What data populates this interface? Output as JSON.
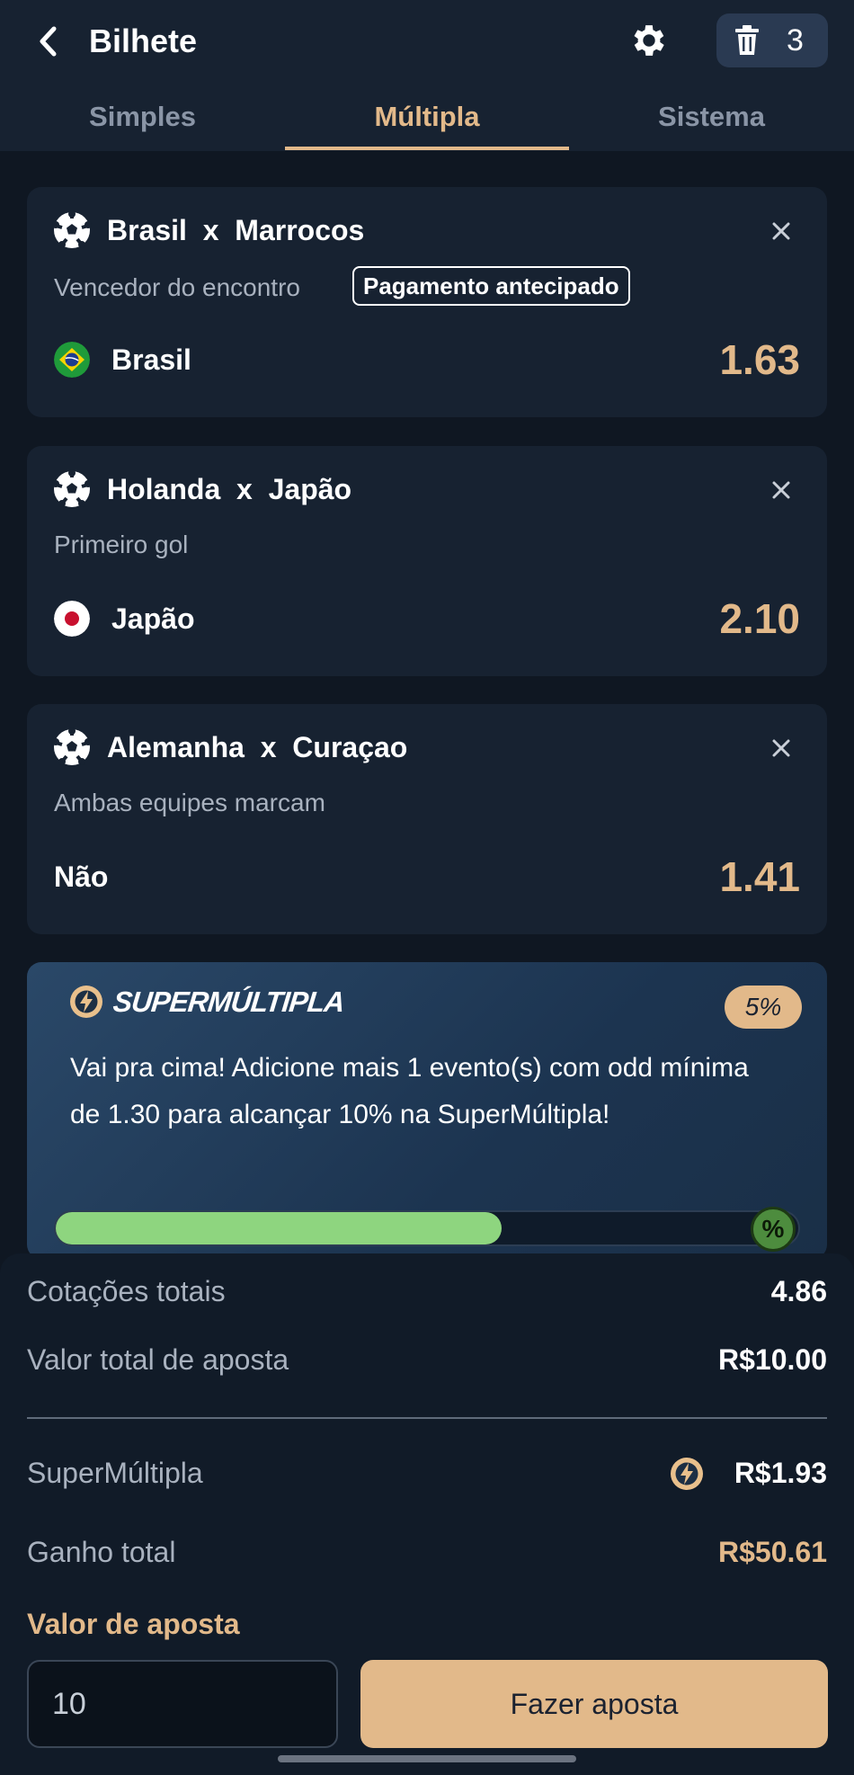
{
  "header": {
    "title": "Bilhete",
    "trash_count": "3"
  },
  "tabs": [
    {
      "label": "Simples",
      "active": false
    },
    {
      "label": "Múltipla",
      "active": true
    },
    {
      "label": "Sistema",
      "active": false
    }
  ],
  "bets": [
    {
      "home": "Brasil",
      "sep": "x",
      "away": "Marrocos",
      "market": "Vencedor do encontro",
      "badge": "Pagamento antecipado",
      "selection": "Brasil",
      "flag": "brazil-flag-icon",
      "odd": "1.63"
    },
    {
      "home": "Holanda",
      "sep": "x",
      "away": "Japão",
      "market": "Primeiro gol",
      "selection": "Japão",
      "flag": "japan-flag-icon",
      "odd": "2.10"
    },
    {
      "home": "Alemanha",
      "sep": "x",
      "away": "Curaçao",
      "market": "Ambas equipes marcam",
      "selection": "Não",
      "odd": "1.41"
    }
  ],
  "promo": {
    "title": "SUPERMÚLTIPLA",
    "current_percent": "5%",
    "message": "Vai pra cima! Adicione mais 1 evento(s) com odd mínima de 1.30 para alcançar 10% na SuperMúltipla!",
    "progress_fraction": 0.6,
    "end_icon_label": "%"
  },
  "summary": {
    "total_odds_label": "Cotações totais",
    "total_odds_value": "4.86",
    "total_stake_label": "Valor total de aposta",
    "total_stake_value": "R$10.00",
    "super_label": "SuperMúltipla",
    "super_value": "R$1.93",
    "total_win_label": "Ganho total",
    "total_win_value": "R$50.61",
    "stake_label": "Valor de aposta",
    "stake_input_value": "10",
    "bet_button_label": "Fazer aposta"
  },
  "colors": {
    "accent": "#e2b98a",
    "background": "#0f1722",
    "card": "#172231",
    "progress": "#8ed57f"
  }
}
